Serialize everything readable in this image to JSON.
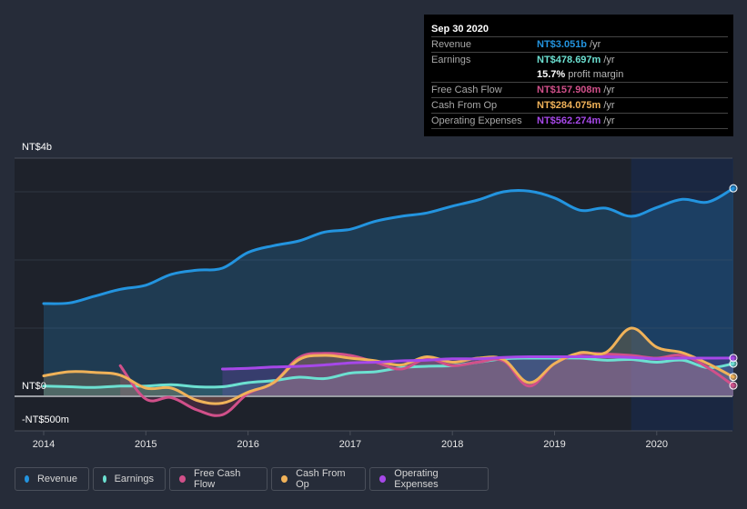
{
  "tooltip": {
    "date": "Sep 30 2020",
    "rows": [
      {
        "label": "Revenue",
        "value": "NT$3.051b",
        "unit": "/yr",
        "color": "#2394df"
      },
      {
        "label": "Earnings",
        "value": "NT$478.697m",
        "unit": "/yr",
        "color": "#6ce0d1"
      },
      {
        "label": "",
        "value": "15.7%",
        "unit": "profit margin",
        "color": "#ffffff"
      },
      {
        "label": "Free Cash Flow",
        "value": "NT$157.908m",
        "unit": "/yr",
        "color": "#d1508a"
      },
      {
        "label": "Cash From Op",
        "value": "NT$284.075m",
        "unit": "/yr",
        "color": "#f0b259"
      },
      {
        "label": "Operating Expenses",
        "value": "NT$562.274m",
        "unit": "/yr",
        "color": "#a648e8"
      }
    ]
  },
  "legend": [
    {
      "label": "Revenue",
      "color": "#2394df"
    },
    {
      "label": "Earnings",
      "color": "#6ce0d1"
    },
    {
      "label": "Free Cash Flow",
      "color": "#d1508a"
    },
    {
      "label": "Cash From Op",
      "color": "#f0b259"
    },
    {
      "label": "Operating Expenses",
      "color": "#a648e8"
    }
  ],
  "chart_data": {
    "type": "area",
    "title": "",
    "xlabel": "",
    "ylabel": "",
    "y_unit": "NT$ billions",
    "ylim": [
      -0.5,
      3.5
    ],
    "xlim": [
      2013.95,
      2020.75
    ],
    "y_tick_labels": [
      {
        "value": 4,
        "label": "NT$4b"
      },
      {
        "value": 0,
        "label": "NT$0"
      },
      {
        "value": -0.5,
        "label": "-NT$500m"
      }
    ],
    "x_ticks": [
      2014,
      2015,
      2016,
      2017,
      2018,
      2019,
      2020
    ],
    "x_tick_labels": [
      "2014",
      "2015",
      "2016",
      "2017",
      "2018",
      "2019",
      "2020"
    ],
    "highlight_range": [
      2019.75,
      2020.75
    ],
    "grid": true,
    "legend_position": "bottom",
    "series": [
      {
        "name": "Revenue",
        "color": "#2394df",
        "x": [
          2014.0,
          2014.25,
          2014.5,
          2014.75,
          2015.0,
          2015.25,
          2015.5,
          2015.75,
          2016.0,
          2016.25,
          2016.5,
          2016.75,
          2017.0,
          2017.25,
          2017.5,
          2017.75,
          2018.0,
          2018.25,
          2018.5,
          2018.75,
          2019.0,
          2019.25,
          2019.5,
          2019.75,
          2020.0,
          2020.25,
          2020.5,
          2020.75
        ],
        "values": [
          1.36,
          1.37,
          1.47,
          1.57,
          1.63,
          1.79,
          1.85,
          1.88,
          2.11,
          2.21,
          2.28,
          2.41,
          2.45,
          2.57,
          2.64,
          2.69,
          2.79,
          2.88,
          3.0,
          3.01,
          2.91,
          2.73,
          2.76,
          2.64,
          2.77,
          2.89,
          2.85,
          3.051
        ]
      },
      {
        "name": "Earnings",
        "color": "#6ce0d1",
        "x": [
          2014.0,
          2014.25,
          2014.5,
          2014.75,
          2015.0,
          2015.25,
          2015.5,
          2015.75,
          2016.0,
          2016.25,
          2016.5,
          2016.75,
          2017.0,
          2017.25,
          2017.5,
          2017.75,
          2018.0,
          2018.25,
          2018.5,
          2018.75,
          2019.0,
          2019.25,
          2019.5,
          2019.75,
          2020.0,
          2020.25,
          2020.5,
          2020.75
        ],
        "values": [
          0.15,
          0.14,
          0.13,
          0.15,
          0.15,
          0.17,
          0.14,
          0.14,
          0.2,
          0.23,
          0.28,
          0.26,
          0.34,
          0.36,
          0.42,
          0.44,
          0.45,
          0.5,
          0.55,
          0.56,
          0.56,
          0.56,
          0.53,
          0.54,
          0.5,
          0.53,
          0.42,
          0.479
        ]
      },
      {
        "name": "Free Cash Flow",
        "color": "#d1508a",
        "x": [
          2014.75,
          2015.0,
          2015.25,
          2015.5,
          2015.75,
          2016.0,
          2016.25,
          2016.5,
          2016.75,
          2017.0,
          2017.25,
          2017.5,
          2017.75,
          2018.0,
          2018.25,
          2018.5,
          2018.75,
          2019.0,
          2019.25,
          2019.5,
          2019.75,
          2020.0,
          2020.25,
          2020.5,
          2020.75
        ],
        "values": [
          0.45,
          -0.04,
          -0.02,
          -0.2,
          -0.27,
          0.04,
          0.2,
          0.57,
          0.63,
          0.6,
          0.5,
          0.4,
          0.55,
          0.45,
          0.5,
          0.52,
          0.15,
          0.48,
          0.62,
          0.62,
          0.6,
          0.56,
          0.6,
          0.42,
          0.158
        ]
      },
      {
        "name": "Cash From Op",
        "color": "#f0b259",
        "x": [
          2014.0,
          2014.25,
          2014.5,
          2014.75,
          2015.0,
          2015.25,
          2015.5,
          2015.75,
          2016.0,
          2016.25,
          2016.5,
          2016.75,
          2017.0,
          2017.25,
          2017.5,
          2017.75,
          2018.0,
          2018.25,
          2018.5,
          2018.75,
          2019.0,
          2019.25,
          2019.5,
          2019.75,
          2020.0,
          2020.25,
          2020.5,
          2020.75
        ],
        "values": [
          0.3,
          0.36,
          0.35,
          0.31,
          0.12,
          0.12,
          -0.06,
          -0.1,
          0.06,
          0.2,
          0.54,
          0.6,
          0.56,
          0.52,
          0.46,
          0.58,
          0.5,
          0.56,
          0.54,
          0.2,
          0.48,
          0.64,
          0.64,
          1.0,
          0.72,
          0.64,
          0.48,
          0.284
        ]
      },
      {
        "name": "Operating Expenses",
        "color": "#a648e8",
        "x": [
          2015.75,
          2016.0,
          2016.25,
          2016.5,
          2016.75,
          2017.0,
          2017.25,
          2017.5,
          2017.75,
          2018.0,
          2018.25,
          2018.5,
          2018.75,
          2019.0,
          2019.25,
          2019.5,
          2019.75,
          2020.0,
          2020.25,
          2020.5,
          2020.75
        ],
        "values": [
          0.4,
          0.41,
          0.43,
          0.44,
          0.46,
          0.49,
          0.5,
          0.52,
          0.53,
          0.55,
          0.55,
          0.57,
          0.58,
          0.58,
          0.58,
          0.58,
          0.57,
          0.55,
          0.56,
          0.56,
          0.562
        ]
      }
    ]
  }
}
